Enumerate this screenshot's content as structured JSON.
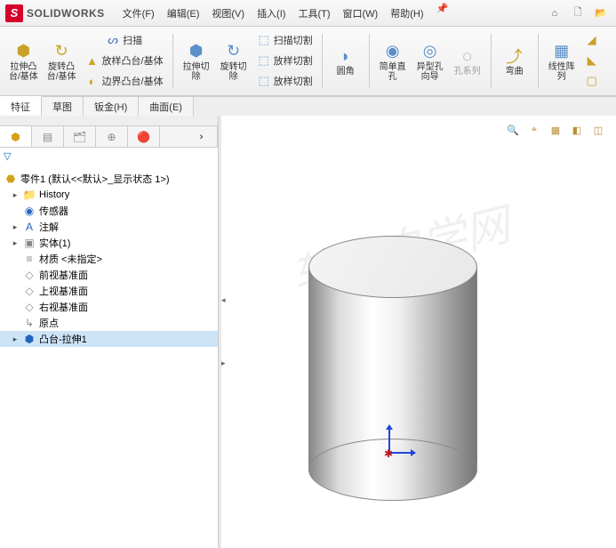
{
  "app": {
    "name": "SOLIDWORKS"
  },
  "menu": {
    "items": [
      "文件(F)",
      "编辑(E)",
      "视图(V)",
      "插入(I)",
      "工具(T)",
      "窗口(W)",
      "帮助(H)"
    ]
  },
  "toolbar": {
    "extrude": "拉伸凸\n台/基体",
    "revolve": "旋转凸\n台/基体",
    "sweep": "扫描",
    "loft": "放样凸台/基体",
    "boundary": "边界凸台/基体",
    "extrude_cut": "拉伸切\n除",
    "revolve_cut": "旋转切\n除",
    "sweep_cut": "扫描切割",
    "loft_cut": "放样切割",
    "loft_cut2": "放样切割",
    "fillet": "圆角",
    "hole_simple": "简单直\n孔",
    "hole_wizard": "异型孔\n向导",
    "hole_series": "孔系列",
    "bend": "弯曲",
    "linear_pattern": "线性阵\n列"
  },
  "tabs": {
    "items": [
      "特征",
      "草图",
      "钣金(H)",
      "曲面(E)"
    ],
    "active": 0
  },
  "tree": {
    "root": "零件1  (默认<<默认>_显示状态 1>)",
    "nodes": [
      {
        "label": "History",
        "exp": "▸",
        "icon": "📁",
        "cls": "gry"
      },
      {
        "label": "传感器",
        "exp": "",
        "icon": "◉",
        "cls": "blu"
      },
      {
        "label": "注解",
        "exp": "▸",
        "icon": "A",
        "cls": "blu"
      },
      {
        "label": "实体(1)",
        "exp": "▸",
        "icon": "▣",
        "cls": "gry"
      },
      {
        "label": "材质 <未指定>",
        "exp": "",
        "icon": "≡",
        "cls": "gry"
      },
      {
        "label": "前视基准面",
        "exp": "",
        "icon": "◇",
        "cls": "gry"
      },
      {
        "label": "上视基准面",
        "exp": "",
        "icon": "◇",
        "cls": "gry"
      },
      {
        "label": "右视基准面",
        "exp": "",
        "icon": "◇",
        "cls": "gry"
      },
      {
        "label": "原点",
        "exp": "",
        "icon": "↳",
        "cls": "gry"
      },
      {
        "label": "凸台-拉伸1",
        "exp": "▸",
        "icon": "⬢",
        "cls": "blu",
        "sel": true
      }
    ]
  },
  "watermark": "软件自学网"
}
